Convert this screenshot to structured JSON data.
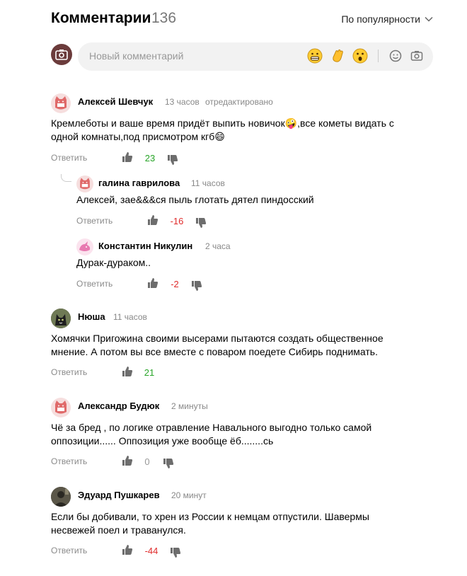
{
  "header": {
    "title": "Комментарии",
    "count": "136",
    "sort_label": "По популярности"
  },
  "composer": {
    "placeholder": "Новый комментарий"
  },
  "comments": [
    {
      "author": "Алексей Шевчук",
      "time": "13 часов",
      "edited": "отредактировано",
      "text": "Кремлеботы и ваше время придёт выпить новичок🤪,все кометы видать с одной комнаты,под присмотром кгб😄",
      "reply": "Ответить",
      "score": "23",
      "replies": [
        {
          "author": "галина гаврилова",
          "time": "11 часов",
          "text": "Алексей, зае&&&ся пыль глотать дятел пиндосский",
          "reply": "Ответить",
          "score": "-16"
        },
        {
          "author": "Константин Никулин",
          "time": "2 часа",
          "text": "Дурак-дураком..",
          "reply": "Ответить",
          "score": "-2"
        }
      ]
    },
    {
      "author": "Нюша",
      "time": "11 часов",
      "text": "Хомячки Пригожина своими высерами пытаются создать общественное мнение. А потом вы все вместе с поваром поедете Сибирь поднимать.",
      "reply": "Ответить",
      "score": "21"
    },
    {
      "author": "Александр Будюк",
      "time": "2 минуты",
      "text": "Чё за бред , по логике отравление Навального выгодно только самой оппозиции...... Оппозиция уже вообще ёб........сь",
      "reply": "Ответить",
      "score": "0"
    },
    {
      "author": "Эдуард Пушкарев",
      "time": "20 минут",
      "text": "Если бы добивали, то хрен из России к немцам отпустили. Шавермы несвежей поел и траванулся.",
      "reply": "Ответить",
      "score": "-44"
    }
  ]
}
